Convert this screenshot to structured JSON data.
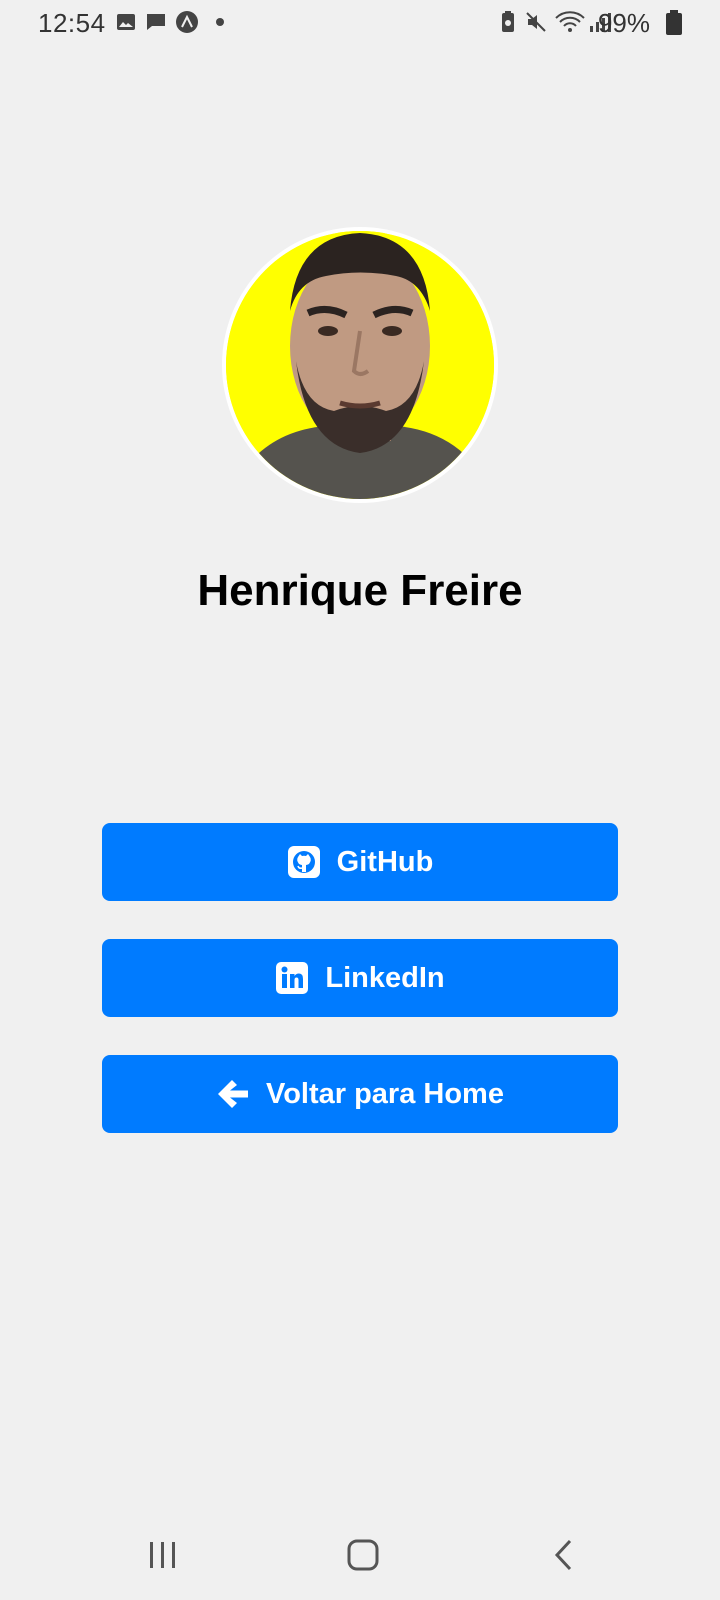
{
  "status_bar": {
    "time": "12:54",
    "battery": "99%",
    "icons": [
      "image-icon",
      "message-icon",
      "expo-icon",
      "dot-icon",
      "battery-saver-icon",
      "mute-icon",
      "wifi-icon",
      "signal-icon",
      "battery-icon"
    ]
  },
  "profile": {
    "name": "Henrique Freire",
    "avatar_background": "#ffff00"
  },
  "buttons": {
    "github": "GitHub",
    "linkedin": "LinkedIn",
    "home": "Voltar para Home"
  },
  "colors": {
    "accent": "#007bff",
    "background": "#f0f0f0",
    "button_text": "#ffffff"
  },
  "nav_bar": {
    "icons": [
      "recent-apps-icon",
      "home-icon",
      "back-icon"
    ]
  }
}
